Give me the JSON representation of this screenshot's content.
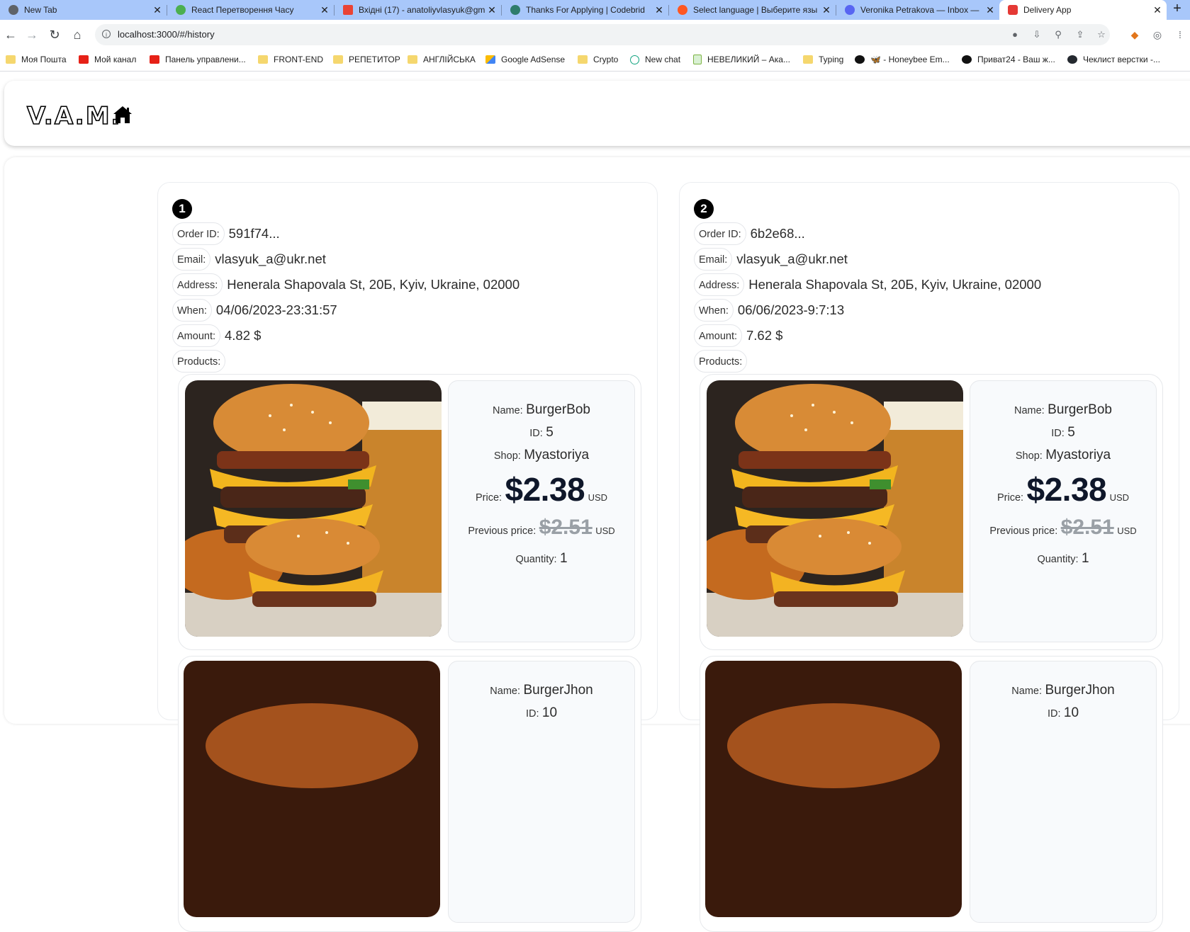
{
  "browser": {
    "tabs": [
      {
        "title": "New Tab",
        "color": "#5f6368"
      },
      {
        "title": "React Перетворення Часу",
        "color": "#4caf50"
      },
      {
        "title": "Вхідні (17) - anatoliyvlasyuk@gm",
        "color": "#ea4335"
      },
      {
        "title": "Thanks For Applying | Codebrid",
        "color": "#2e7d6b"
      },
      {
        "title": "Select language | Выберите язы",
        "color": "#ff5722"
      },
      {
        "title": "Veronika Petrakova — Inbox — ",
        "color": "#5865f2"
      },
      {
        "title": "Delivery App",
        "color": "#e53935"
      }
    ],
    "url": "localhost:3000/#/history",
    "bookmarks": [
      {
        "label": "Моя Пошта",
        "type": "folder"
      },
      {
        "label": "Мой канал",
        "type": "yt"
      },
      {
        "label": "Панель управлени...",
        "type": "yt"
      },
      {
        "label": "FRONT-END",
        "type": "folder"
      },
      {
        "label": "РЕПЕТИТОР",
        "type": "folder"
      },
      {
        "label": "АНГЛІЙСЬКА",
        "type": "folder"
      },
      {
        "label": "Google AdSense",
        "type": "adsense"
      },
      {
        "label": "Crypto",
        "type": "folder"
      },
      {
        "label": "New chat",
        "type": "chat"
      },
      {
        "label": "НЕВЕЛИКИЙ – Ака...",
        "type": "doc"
      },
      {
        "label": "Typing",
        "type": "folder"
      },
      {
        "label": "🦋 - Honeybee Em...",
        "type": "dark"
      },
      {
        "label": "Приват24 - Ваш ж...",
        "type": "dark"
      },
      {
        "label": "Чеклист верстки -...",
        "type": "github"
      }
    ]
  },
  "app": {
    "logo": "V.A.M.",
    "labels": {
      "order_id": "Order ID:",
      "email": "Email:",
      "address": "Address:",
      "when": "When:",
      "amount": "Amount:",
      "products": "Products:",
      "name": "Name:",
      "id": "ID:",
      "shop": "Shop:",
      "price": "Price:",
      "previous_price": "Previous price:",
      "quantity": "Quantity:",
      "currency": "USD"
    },
    "orders": [
      {
        "number": "1",
        "order_id": "591f74...",
        "email": "vlasyuk_a@ukr.net",
        "address": "Henerala Shapovala St, 20Б, Kyiv, Ukraine, 02000",
        "when": "04/06/2023-23:31:57",
        "amount": "4.82 $",
        "products": [
          {
            "name": "BurgerBob",
            "id": "5",
            "shop": "Myastoriya",
            "price": "$2.38",
            "previous_price": "$2.51",
            "quantity": "1"
          },
          {
            "name": "BurgerJhon",
            "id": "10"
          }
        ]
      },
      {
        "number": "2",
        "order_id": "6b2e68...",
        "email": "vlasyuk_a@ukr.net",
        "address": "Henerala Shapovala St, 20Б, Kyiv, Ukraine, 02000",
        "when": "06/06/2023-9:7:13",
        "amount": "7.62 $",
        "products": [
          {
            "name": "BurgerBob",
            "id": "5",
            "shop": "Myastoriya",
            "price": "$2.38",
            "previous_price": "$2.51",
            "quantity": "1"
          },
          {
            "name": "BurgerJhon",
            "id": "10"
          }
        ]
      }
    ]
  }
}
